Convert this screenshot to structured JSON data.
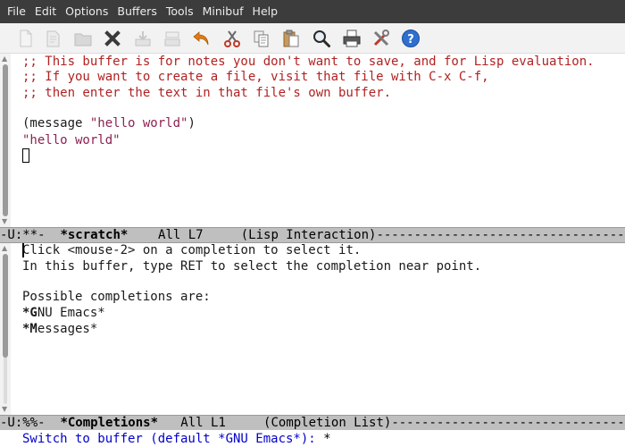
{
  "menubar": {
    "items": [
      "File",
      "Edit",
      "Options",
      "Buffers",
      "Tools",
      "Minibuf",
      "Help"
    ]
  },
  "toolbar": {
    "buttons": [
      {
        "icon": "new-file-icon",
        "enabled": false
      },
      {
        "icon": "open-file-icon",
        "enabled": false
      },
      {
        "icon": "open-directory-icon",
        "enabled": false
      },
      {
        "icon": "close-buffer-icon",
        "enabled": true
      },
      {
        "icon": "save-icon",
        "enabled": false
      },
      {
        "icon": "save-as-icon",
        "enabled": false
      },
      {
        "icon": "undo-icon",
        "enabled": true
      },
      {
        "icon": "cut-icon",
        "enabled": true
      },
      {
        "icon": "copy-icon",
        "enabled": true
      },
      {
        "icon": "paste-icon",
        "enabled": true
      },
      {
        "icon": "search-icon",
        "enabled": true
      },
      {
        "icon": "print-icon",
        "enabled": true
      },
      {
        "icon": "customize-icon",
        "enabled": true
      },
      {
        "icon": "help-icon",
        "enabled": true
      }
    ]
  },
  "scratch": {
    "comment_lines": [
      ";; This buffer is for notes you don't want to save, and for Lisp evaluation.",
      ";; If you want to create a file, visit that file with C-x C-f,",
      ";; then enter the text in that file's own buffer."
    ],
    "code_open": "(message ",
    "code_string": "\"hello world\"",
    "code_close": ")",
    "result": "\"hello world\""
  },
  "scratch_modeline": {
    "status": "-U:**-  ",
    "buffer_name": "*scratch*",
    "position": "    All L7     ",
    "mode": "(Lisp Interaction)",
    "filler": "------------------------------------------"
  },
  "completions": {
    "line1_first": "C",
    "line1_rest": "lick <mouse-2> on a completion to select it.",
    "line2": "In this buffer, type RET to select the completion near point.",
    "line4": "Possible completions are:",
    "items": [
      {
        "first": "*G",
        "rest": "NU Emacs*"
      },
      {
        "first": "*M",
        "rest": "essages*"
      }
    ]
  },
  "completions_modeline": {
    "status": "-U:%%-  ",
    "buffer_name": "*Completions*",
    "position": "   All L1     ",
    "mode": "(Completion List)",
    "filler": "------------------------------------------"
  },
  "minibuffer": {
    "prompt": "Switch to buffer (default *GNU Emacs*): ",
    "input": "*"
  },
  "colors": {
    "comment": "#b22222",
    "string": "#8b2252",
    "prompt": "#0000cd",
    "menubar_bg": "#3c3c3c",
    "modeline_bg": "#bfbfbf"
  }
}
